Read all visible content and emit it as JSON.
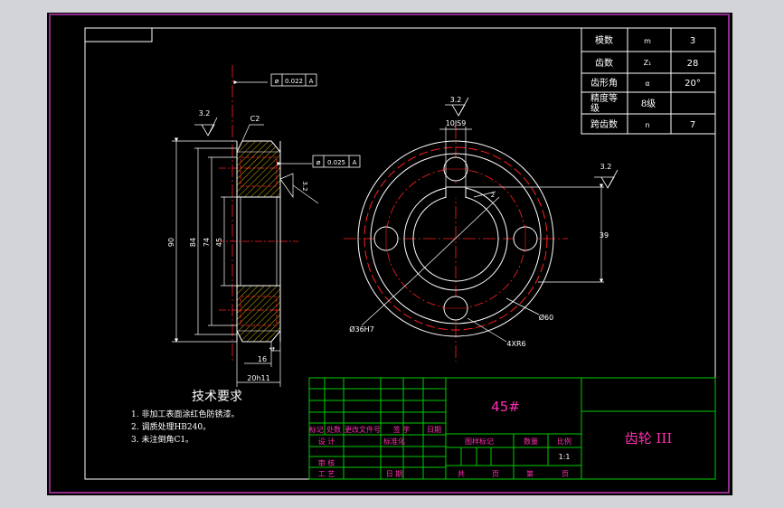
{
  "colors": {
    "window": "#d2d4d8",
    "paper": "#000000",
    "frame": "#8e2a8a",
    "line": "#ffffff",
    "center": "#ff2020",
    "title_line": "#00cc00",
    "title_text": "#ff2fb0",
    "hatch": "#ffdd00"
  },
  "params": {
    "rows": [
      {
        "name": "模数",
        "sym": "m",
        "val": "3"
      },
      {
        "name": "齿数",
        "sym": "Z₁",
        "val": "28"
      },
      {
        "name": "齿形角",
        "sym": "α",
        "val": "20°"
      },
      {
        "name1": "精度等",
        "name2": "级",
        "sym": "8级",
        "val": ""
      },
      {
        "name": "跨齿数",
        "sym": "n",
        "val": "7"
      }
    ]
  },
  "section": {
    "roughness": "3.2",
    "chamfer": "C2",
    "tol1_val": "0.022",
    "tol1_ref": "A",
    "tol2_val": "0.025",
    "tol2_ref": "A",
    "roughness_side": "3.2",
    "dim_90": "90",
    "dim_84": "84",
    "dim_74": "74",
    "dim_45": "45",
    "dim_4": "4",
    "dim_16": "16",
    "dim_20": "20h11"
  },
  "front": {
    "roughness_top": "3.2",
    "keyway": "10JS9",
    "dim_39": "39",
    "roughness_right": "3.2",
    "bore": "Ø36H7",
    "pitch": "Ø60",
    "holes": "4XR6",
    "ang": "2"
  },
  "tech": {
    "title": "技术要求",
    "items": [
      "1. 非加工表面涂红色防锈漆。",
      "2. 调质处理HB240。",
      "3. 未注倒角C1。"
    ]
  },
  "title_block": {
    "material": "45#",
    "part_name": "齿轮 III",
    "row_mark": [
      "标记",
      "处数",
      "更改文件号",
      "签 字",
      "日期"
    ],
    "design": "设 计",
    "standard": "标准化",
    "review": "审 核",
    "process": "工 艺",
    "date": "日 期",
    "stage_mark": "图样标记",
    "weight": "数量",
    "scale": "比例",
    "scale_val": "1:1",
    "total": "共",
    "page1": "页",
    "nth": "第",
    "page2": "页"
  }
}
